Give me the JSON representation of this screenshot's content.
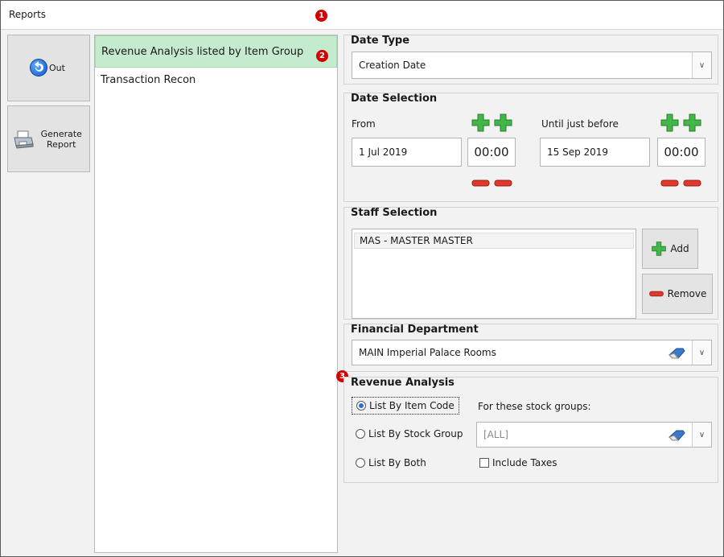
{
  "window": {
    "title": "Reports"
  },
  "badges": {
    "one": "1",
    "two": "2",
    "three": "3"
  },
  "commands": {
    "out_label": "Out",
    "generate_label": "Generate Report"
  },
  "reports": [
    {
      "label": "Revenue Analysis listed by Item Group",
      "selected": true
    },
    {
      "label": "Transaction Recon",
      "selected": false
    }
  ],
  "date_type": {
    "title": "Date Type",
    "value": "Creation Date"
  },
  "date_selection": {
    "title": "Date Selection",
    "from_label": "From",
    "from_date": "1 Jul 2019",
    "from_time": "00:00",
    "until_label": "Until just before",
    "until_date": "15 Sep 2019",
    "until_time": "00:00"
  },
  "staff_selection": {
    "title": "Staff Selection",
    "items": [
      "MAS - MASTER MASTER"
    ],
    "add_label": "Add",
    "remove_label": "Remove"
  },
  "financial_department": {
    "title": "Financial Department",
    "value": "MAIN Imperial Palace Rooms"
  },
  "revenue_analysis": {
    "title": "Revenue Analysis",
    "option_item_code": "List By Item Code",
    "option_stock_group": "List By Stock Group",
    "option_both": "List By Both",
    "selected_option": "List By Item Code",
    "stock_groups_label": "For these stock groups:",
    "stock_groups_value": "[ALL]",
    "include_taxes_label": "Include Taxes",
    "include_taxes": false
  },
  "colors": {
    "selected_row": "#c5ebce",
    "badge": "#d40000",
    "plus_green": "#3cb43c",
    "minus_red": "#d9362b"
  }
}
